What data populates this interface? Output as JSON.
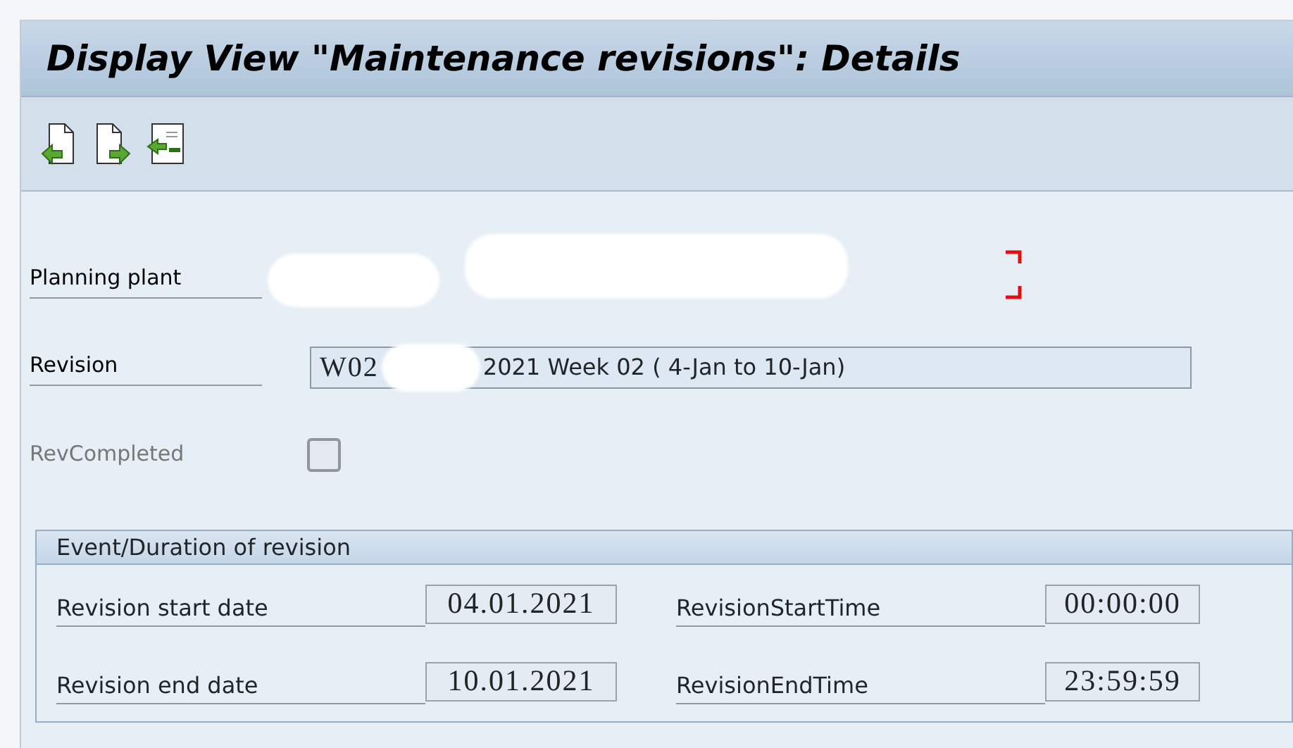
{
  "window": {
    "title": "Display View \"Maintenance revisions\": Details"
  },
  "toolbar": {
    "buttons": [
      {
        "kind": "previous"
      },
      {
        "kind": "next"
      },
      {
        "kind": "compare"
      }
    ]
  },
  "fields": [
    {
      "kind": "plant",
      "label": "Planning plant",
      "required": true
    },
    {
      "kind": "text",
      "label": "Revision",
      "value": "2021 Week 02 ( 4-Jan to 10-Jan)",
      "prefix": "W02"
    },
    {
      "kind": "checkbox",
      "label": "RevCompleted",
      "checked": false,
      "disabled": true
    }
  ],
  "group": {
    "title": "Event/Duration of revision",
    "rows": [
      {
        "date_label": "Revision start date",
        "date": "04.01.2021",
        "time_label": "RevisionStartTime",
        "time": "00:00:00"
      },
      {
        "date_label": "Revision end date",
        "date": "10.01.2021",
        "time_label": "RevisionEndTime",
        "time": "23:59:59"
      }
    ]
  }
}
